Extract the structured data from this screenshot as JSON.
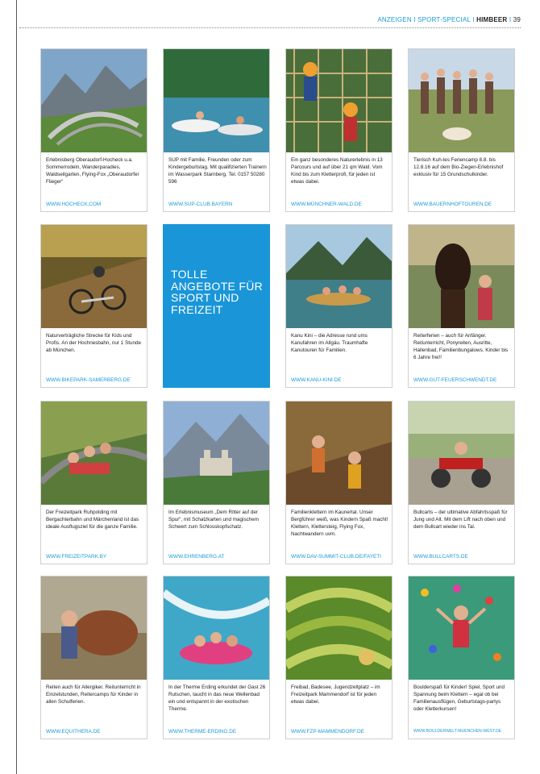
{
  "header": {
    "section": "ANZEIGEN",
    "separator": " I ",
    "topic": "SPORT-SPECIAL",
    "magazine": "HIMBEER",
    "page_number": "39"
  },
  "feature": {
    "title": "TOLLE ANGEBOTE FÜR SPORT UND FREIZEIT"
  },
  "cards": [
    {
      "image": "mountain-coaster-photo",
      "text": "Erlebnisberg Oberaudorf-Hocheck u.a. Sommerrodeln, Wanderparadies, Waldseilgarten, Flying-Fox „Oberaudorfer Flieger“",
      "url": "WWW.HOCHECK.COM"
    },
    {
      "image": "paddle-boats-photo",
      "text": "SUP mit Familie, Freunden oder zum Kindergeburtstag. Mit qualifizierten Trainern im Wasserpark Starnberg. Tel. 0157 50280 596",
      "url": "WWW.SUP-CLUB.BAYERN"
    },
    {
      "image": "climbing-park-photo",
      "text": "Ein ganz besonderes Naturerlebnis in 13 Parcours und auf über 21 qm Wald. Vom Kind bis zum Kletterprofi, für jeden ist etwas dabei.",
      "url": "WWW.MÜNCHNER-WALD.DE"
    },
    {
      "image": "kids-with-goats-photo",
      "text": "Tierisch Kuh-les Feriencamp 8.8. bis 12.8.16 auf dem Bio-Ziegen-Erlebnishof exklusiv für 15 Grundschulkinder.",
      "url": "WWW.BAUERNHOFTOUREN.DE"
    },
    {
      "image": "mountain-bike-photo",
      "text": "Naturverträgliche Strecke für Kids und Profis. An der Hochriesbahn, nur 1 Stunde ab München.",
      "url": "WWW.BIKEPARK-SAMERBERG.DE"
    },
    {
      "image": "canoe-lake-photo",
      "text": "Kanu Kini – die Adresse rund ums Kanufahren im Allgäu. Traumhafte Kanutouren für Familien.",
      "url": "WWW.KANU-KINI.DE"
    },
    {
      "image": "horse-and-child-photo",
      "text": "Reiterferien – auch für Anfänger. Reitunterricht, Ponyreiten, Ausritte, Hallenbad, Familienbungalows. Kinder bis 6 Jahre frei!!",
      "url": "WWW.GUT-FEUERSCHWENDT.DE"
    },
    {
      "image": "roller-coaster-family-photo",
      "text": "Der Freizeitpark Ruhpolding mit Bergachterbahn und Märchenland ist das ideale Ausflugsziel für die ganze Familie.",
      "url": "WWW.FREIZEITPARK.BY"
    },
    {
      "image": "castle-mountain-photo",
      "text": "Im Erlebnismuseum „Dem Ritter auf der Spur“, mit Schatzkarten und magischem Schwert zum Schlosskopfschatz.",
      "url": "WWW.EHRENBERG.AT"
    },
    {
      "image": "rock-climbing-kids-photo",
      "text": "Familienklettern im Kaunertal. Unser Bergführer weiß, was Kindern Spaß macht! Klettern, Klettersteig, Flying Fox, Nachtwandern uvm.",
      "url": "WWW.DAV-SUMMIT-CLUB.DE/FAYETI"
    },
    {
      "image": "bullcarts-photo",
      "text": "Bullcarts – der ultimative Abfahrtsspaß für Jung und Alt. Mit dem Lift nach oben und dem Bullcart wieder ins Tal.",
      "url": "WWW.BULLCARTS.DE"
    },
    {
      "image": "child-with-horse-photo",
      "text": "Reiten auch für Allergiker. Reitunterricht in Einzelstunden, Reitercamps für Kinder in allen Schulferien.",
      "url": "WWW.EQUITHERA.DE"
    },
    {
      "image": "water-slide-family-photo",
      "text": "In der Therme Erding erkundet der Gast 26 Rutschen, taucht in das neue Wellenbad ein und entspannt in der exotischen Therme.",
      "url": "WWW.THERME-ERDING.DE"
    },
    {
      "image": "park-landscape-photo",
      "text": "Freibad, Badesee, Jugendzeltplatz – im Freizeitpark Mammendorf ist für jeden etwas dabei.",
      "url": "WWW.FZP-MAMMENDORF.DE"
    },
    {
      "image": "bouldering-kid-photo",
      "text": "Boulderspaß für Kinder! Spiel, Sport und Spannung beim Klettern – egal ob bei Familienausflügen, Geburtstags-partys oder Kletterkursen!",
      "url": "WWW.BOULDERWELT-MUENCHEN-WEST.DE"
    }
  ]
}
